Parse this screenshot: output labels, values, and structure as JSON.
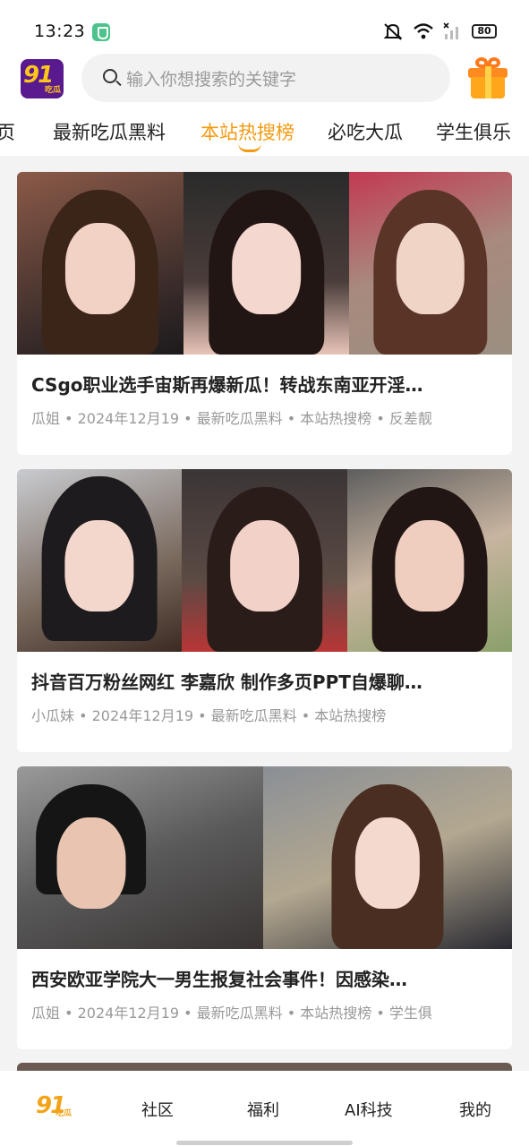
{
  "status_bar": {
    "time": "13:23",
    "battery": "80",
    "icons": [
      "shield-icon",
      "mute-icon",
      "wifi-icon",
      "signal-icon",
      "battery-icon"
    ]
  },
  "header": {
    "logo_text": "91",
    "logo_sub": "吃瓜",
    "search_placeholder": "输入你想搜索的关键字",
    "gift_icon": "gift-icon"
  },
  "tabs": [
    {
      "label": "页",
      "active": false
    },
    {
      "label": "最新吃瓜黑料",
      "active": false
    },
    {
      "label": "本站热搜榜",
      "active": true
    },
    {
      "label": "必吃大瓜",
      "active": false
    },
    {
      "label": "学生俱乐",
      "active": false
    }
  ],
  "colors": {
    "accent": "#f39a12",
    "meta_text": "#999999",
    "logo_bg": "#5a1a8f"
  },
  "posts": [
    {
      "title": "CSgo职业选手宙斯再爆新瓜！转战东南亚开淫…",
      "meta": "瓜姐 • 2024年12月19 • 最新吃瓜黑料 • 本站热搜榜 • 反差靓"
    },
    {
      "title": "抖音百万粉丝网红 李嘉欣 制作多页PPT自爆聊…",
      "meta": "小瓜妹 • 2024年12月19 • 最新吃瓜黑料 • 本站热搜榜"
    },
    {
      "title": "西安欧亚学院大一男生报复社会事件！因感染…",
      "meta": "瓜姐 • 2024年12月19 • 最新吃瓜黑料 • 本站热搜榜 • 学生俱"
    }
  ],
  "bottom_nav": {
    "home_logo": "91",
    "home_logo_sub": "吃瓜",
    "items": [
      "社区",
      "福利",
      "AI科技",
      "我的"
    ]
  }
}
